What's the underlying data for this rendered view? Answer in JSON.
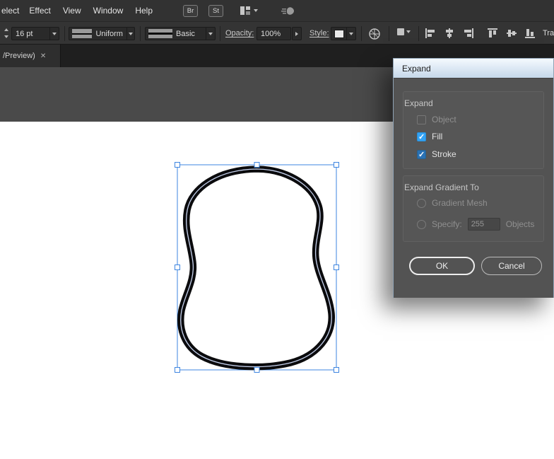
{
  "menu": {
    "items": [
      "elect",
      "Effect",
      "View",
      "Window",
      "Help"
    ],
    "badges": [
      "Br",
      "St"
    ]
  },
  "control_bar": {
    "stroke_size": "16 pt",
    "width_profile": "Uniform",
    "brush": "Basic",
    "opacity_label": "Opacity:",
    "opacity_value": "100%",
    "style_label": "Style:",
    "transform_label": "Tra"
  },
  "document_tab": {
    "title": "/Preview)",
    "close_glyph": "✕"
  },
  "dialog": {
    "title": "Expand",
    "expand_group": {
      "label": "Expand",
      "options": [
        {
          "label": "Object",
          "checked": false,
          "enabled": false
        },
        {
          "label": "Fill",
          "checked": true,
          "enabled": true
        },
        {
          "label": "Stroke",
          "checked": true,
          "enabled": true
        }
      ]
    },
    "gradient_group": {
      "label": "Expand Gradient To",
      "gradient_mesh_label": "Gradient Mesh",
      "specify_label": "Specify:",
      "specify_value": "255",
      "specify_suffix": "Objects"
    },
    "buttons": {
      "ok": "OK",
      "cancel": "Cancel"
    }
  },
  "icons": {
    "check": "✓"
  },
  "colors": {
    "accent_blue": "#33a3f5",
    "selection_blue": "#3d85e0",
    "titlebar_light": "#dce9f5",
    "panel_gray": "#535353",
    "ui_dark": "#323232"
  }
}
